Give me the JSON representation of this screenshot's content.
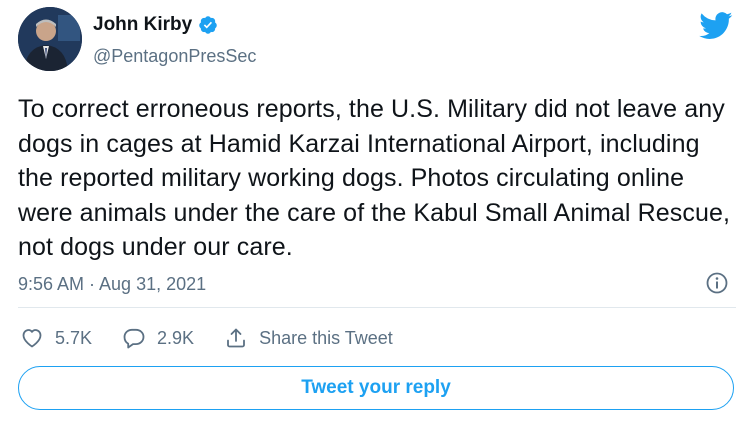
{
  "author": {
    "display_name": "John Kirby",
    "handle": "@PentagonPresSec",
    "verified": true,
    "avatar_icon": "person-avatar"
  },
  "brand": {
    "icon": "twitter-bird-icon",
    "color": "#1da1f2"
  },
  "tweet": {
    "text": "To correct erroneous reports, the U.S. Military did not leave any dogs in cages at Hamid Karzai International Airport, including the reported military working dogs. Photos circulating online were animals under the care of the Kabul Small Animal Rescue, not dogs under our care.",
    "timestamp": "9:56 AM · Aug 31, 2021"
  },
  "actions": {
    "likes": "5.7K",
    "replies": "2.9K",
    "share_label": "Share this Tweet"
  },
  "reply_button": {
    "label": "Tweet your reply"
  },
  "colors": {
    "accent": "#1da1f2",
    "secondary_text": "#5b7083",
    "primary_text": "#0f1419"
  }
}
